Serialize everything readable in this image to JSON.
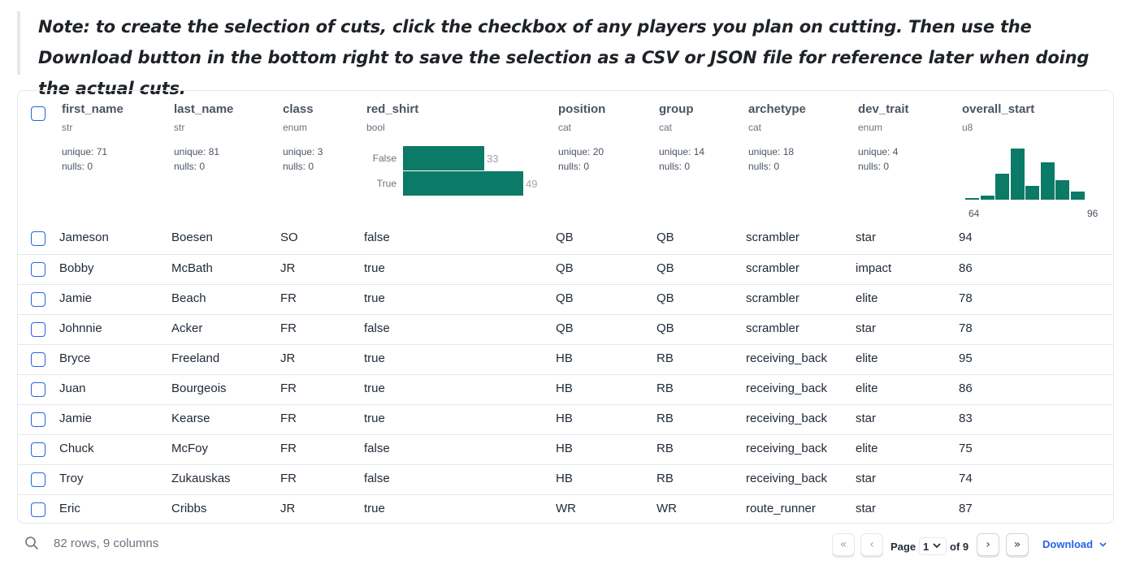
{
  "note": "Note: to create the selection of cuts, click the checkbox of any players you plan on cutting. Then use the Download button in the bottom right to save the selection as a CSV or JSON file for reference later when doing the actual cuts.",
  "columns": [
    {
      "name": "first_name",
      "type": "str",
      "stats": [
        "unique: 71",
        "nulls: 0"
      ]
    },
    {
      "name": "last_name",
      "type": "str",
      "stats": [
        "unique: 81",
        "nulls: 0"
      ]
    },
    {
      "name": "class",
      "type": "enum",
      "stats": [
        "unique: 3",
        "nulls: 0"
      ]
    },
    {
      "name": "red_shirt",
      "type": "bool",
      "stats": []
    },
    {
      "name": "position",
      "type": "cat",
      "stats": [
        "unique: 20",
        "nulls: 0"
      ]
    },
    {
      "name": "group",
      "type": "cat",
      "stats": [
        "unique: 14",
        "nulls: 0"
      ]
    },
    {
      "name": "archetype",
      "type": "cat",
      "stats": [
        "unique: 18",
        "nulls: 0"
      ]
    },
    {
      "name": "dev_trait",
      "type": "enum",
      "stats": [
        "unique: 4",
        "nulls: 0"
      ]
    },
    {
      "name": "overall_start",
      "type": "u8",
      "stats": []
    }
  ],
  "red_shirt_summary": {
    "false_label": "False",
    "false_count": 33,
    "true_label": "True",
    "true_count": 49
  },
  "overall_start_hist": {
    "min_label": "64",
    "max_label": "96",
    "bins": [
      1,
      2,
      13,
      26,
      7,
      19,
      10,
      4
    ]
  },
  "rows": [
    [
      "Jameson",
      "Boesen",
      "SO",
      "false",
      "QB",
      "QB",
      "scrambler",
      "star",
      "94"
    ],
    [
      "Bobby",
      "McBath",
      "JR",
      "true",
      "QB",
      "QB",
      "scrambler",
      "impact",
      "86"
    ],
    [
      "Jamie",
      "Beach",
      "FR",
      "true",
      "QB",
      "QB",
      "scrambler",
      "elite",
      "78"
    ],
    [
      "Johnnie",
      "Acker",
      "FR",
      "false",
      "QB",
      "QB",
      "scrambler",
      "star",
      "78"
    ],
    [
      "Bryce",
      "Freeland",
      "JR",
      "true",
      "HB",
      "RB",
      "receiving_back",
      "elite",
      "95"
    ],
    [
      "Juan",
      "Bourgeois",
      "FR",
      "true",
      "HB",
      "RB",
      "receiving_back",
      "elite",
      "86"
    ],
    [
      "Jamie",
      "Kearse",
      "FR",
      "true",
      "HB",
      "RB",
      "receiving_back",
      "star",
      "83"
    ],
    [
      "Chuck",
      "McFoy",
      "FR",
      "false",
      "HB",
      "RB",
      "receiving_back",
      "elite",
      "75"
    ],
    [
      "Troy",
      "Zukauskas",
      "FR",
      "false",
      "HB",
      "RB",
      "receiving_back",
      "star",
      "74"
    ],
    [
      "Eric",
      "Cribbs",
      "JR",
      "true",
      "WR",
      "WR",
      "route_runner",
      "star",
      "87"
    ]
  ],
  "footer": {
    "summary": "82 rows, 9 columns",
    "page_label": "Page",
    "page_value": "1",
    "of_label": "of 9",
    "download_label": "Download",
    "first_glyph": "«",
    "prev_glyph": "‹",
    "next_glyph": "›",
    "last_glyph": "»"
  },
  "colors": {
    "accent": "#2563eb",
    "bar": "#0b7a66"
  },
  "icons": {
    "search": "search-icon",
    "chevron": "chevron-down-icon"
  }
}
